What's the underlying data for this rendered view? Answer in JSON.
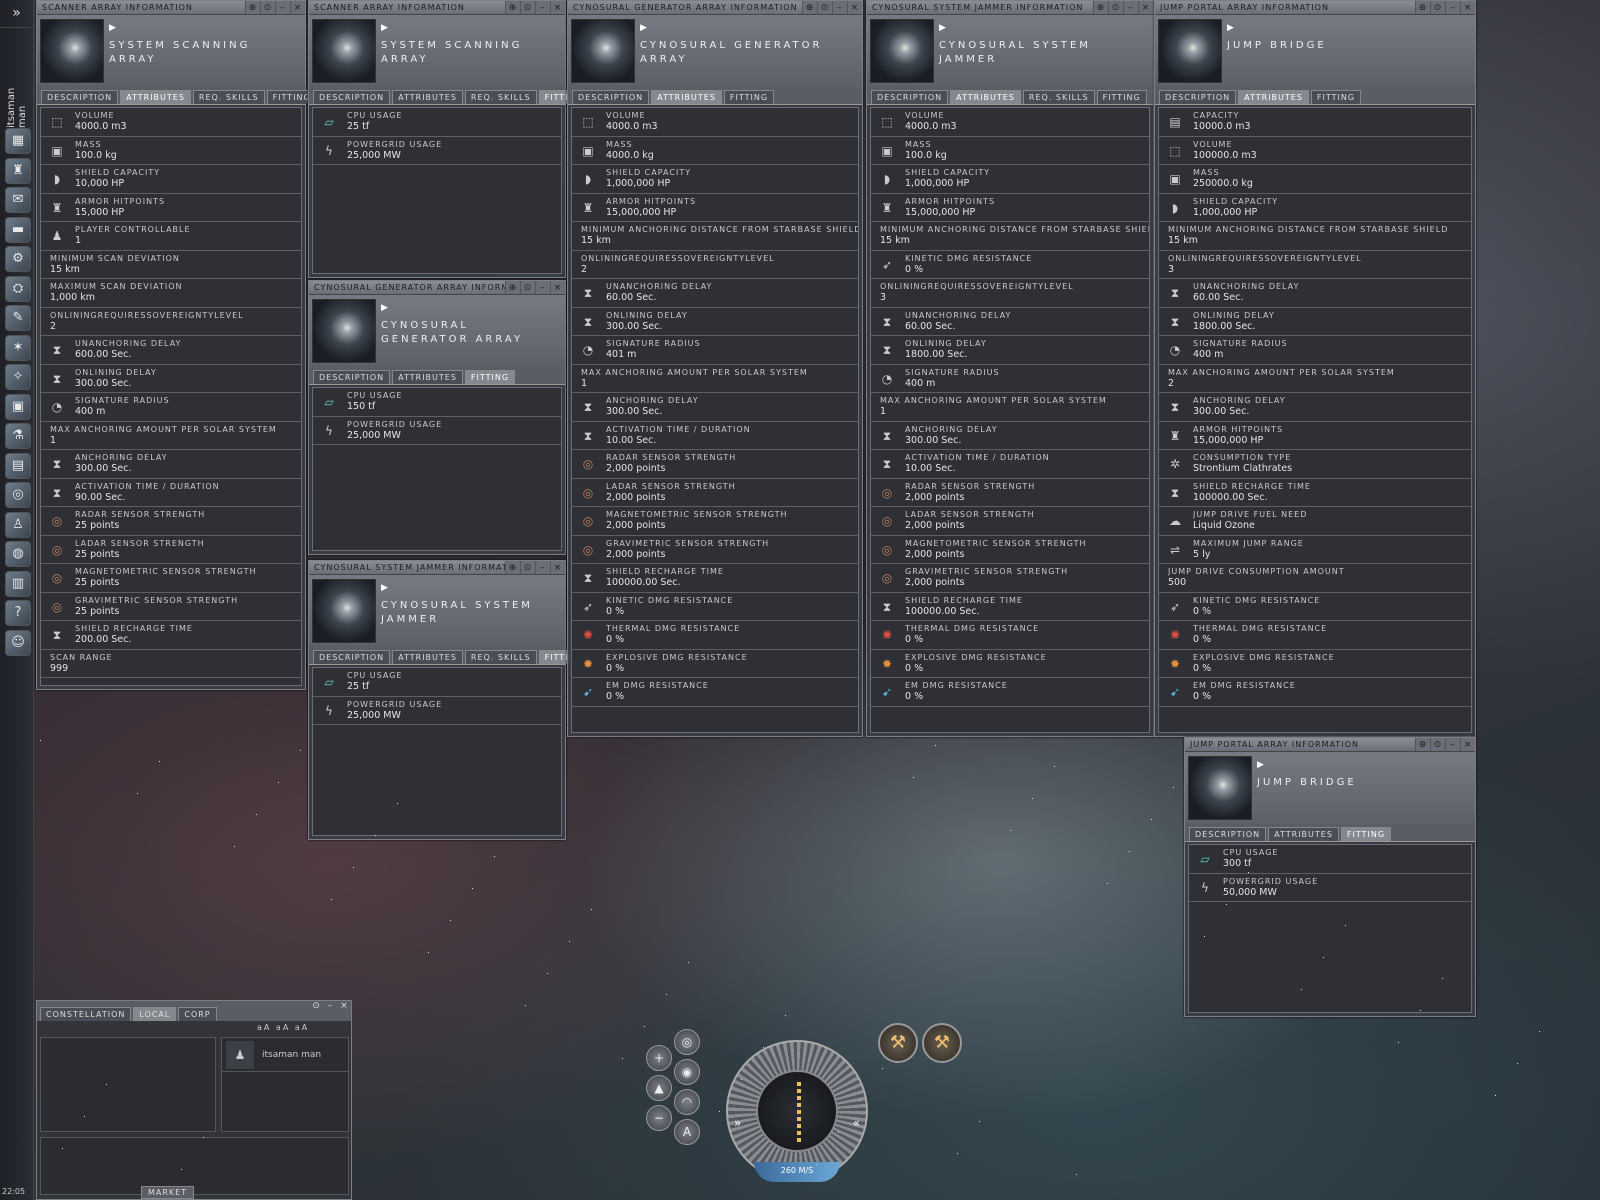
{
  "neocom": {
    "pilot": "itsaman man",
    "top": "»",
    "clock": "22:05",
    "buttons": [
      "▦",
      "♜",
      "✉",
      "▬",
      "⚙",
      "⛭",
      "✎",
      "✶",
      "✧",
      "▣",
      "⚗",
      "▤",
      "◎",
      "♙",
      "◍",
      "▥",
      "?",
      "☺"
    ]
  },
  "windows": [
    {
      "title": "SCANNER ARRAY INFORMATION",
      "name": "SYSTEM SCANNING ARRAY",
      "tabs": [
        "DESCRIPTION",
        "ATTRIBUTES",
        "REQ. SKILLS",
        "FITTING"
      ],
      "active": 1,
      "rows": [
        [
          "VOLUME",
          "4000.0 m3",
          "cube"
        ],
        [
          "MASS",
          "100.0 kg",
          "mass"
        ],
        [
          "SHIELD CAPACITY",
          "10,000 HP",
          "shield"
        ],
        [
          "ARMOR HITPOINTS",
          "15,000 HP",
          "armor"
        ],
        [
          "PLAYER CONTROLLABLE",
          "1",
          "person"
        ],
        [
          "MINIMUM SCAN DEVIATION",
          "15 km",
          ""
        ],
        [
          "MAXIMUM SCAN DEVIATION",
          "1,000 km",
          ""
        ],
        [
          "ONLININGREQUIRESSOVEREIGNTYLEVEL",
          "2",
          ""
        ],
        [
          "UNANCHORING DELAY",
          "600.00 Sec.",
          "hourglass"
        ],
        [
          "ONLINING DELAY",
          "300.00 Sec.",
          "hourglass"
        ],
        [
          "SIGNATURE RADIUS",
          "400 m",
          "signature"
        ],
        [
          "MAX ANCHORING AMOUNT PER SOLAR SYSTEM",
          "1",
          ""
        ],
        [
          "ANCHORING DELAY",
          "300.00 Sec.",
          "hourglass"
        ],
        [
          "ACTIVATION TIME / DURATION",
          "90.00 Sec.",
          "hourglass"
        ],
        [
          "RADAR SENSOR STRENGTH",
          "25 points",
          "sensor"
        ],
        [
          "LADAR SENSOR STRENGTH",
          "25 points",
          "sensor"
        ],
        [
          "MAGNETOMETRIC SENSOR STRENGTH",
          "25 points",
          "sensor"
        ],
        [
          "GRAVIMETRIC SENSOR STRENGTH",
          "25 points",
          "sensor"
        ],
        [
          "SHIELD RECHARGE TIME",
          "200.00 Sec.",
          "hourglass"
        ],
        [
          "SCAN RANGE",
          "999",
          ""
        ]
      ]
    },
    {
      "title": "SCANNER ARRAY INFORMATION",
      "name": "SYSTEM SCANNING ARRAY",
      "tabs": [
        "DESCRIPTION",
        "ATTRIBUTES",
        "REQ. SKILLS",
        "FITTING"
      ],
      "active": 3,
      "rows": [
        [
          "CPU USAGE",
          "25 tf",
          "cpu"
        ],
        [
          "POWERGRID USAGE",
          "25,000 MW",
          "power"
        ]
      ]
    },
    {
      "title": "CYNOSURAL GENERATOR ARRAY INFORMATI",
      "name": "CYNOSURAL GENERATOR ARRAY",
      "tabs": [
        "DESCRIPTION",
        "ATTRIBUTES",
        "FITTING"
      ],
      "active": 2,
      "rows": [
        [
          "CPU USAGE",
          "150 tf",
          "cpu"
        ],
        [
          "POWERGRID USAGE",
          "25,000 MW",
          "power"
        ]
      ]
    },
    {
      "title": "CYNOSURAL SYSTEM JAMMER INFORMATI",
      "name": "CYNOSURAL SYSTEM JAMMER",
      "tabs": [
        "DESCRIPTION",
        "ATTRIBUTES",
        "REQ. SKILLS",
        "FITTING"
      ],
      "active": 3,
      "rows": [
        [
          "CPU USAGE",
          "25 tf",
          "cpu"
        ],
        [
          "POWERGRID USAGE",
          "25,000 MW",
          "power"
        ]
      ]
    },
    {
      "title": "CYNOSURAL GENERATOR ARRAY INFORMATION",
      "name": "CYNOSURAL GENERATOR ARRAY",
      "tabs": [
        "DESCRIPTION",
        "ATTRIBUTES",
        "FITTING"
      ],
      "active": 1,
      "rows": [
        [
          "VOLUME",
          "4000.0 m3",
          "cube"
        ],
        [
          "MASS",
          "4000.0 kg",
          "mass"
        ],
        [
          "SHIELD CAPACITY",
          "1,000,000 HP",
          "shield"
        ],
        [
          "ARMOR HITPOINTS",
          "15,000,000 HP",
          "armor"
        ],
        [
          "MINIMUM ANCHORING DISTANCE FROM STARBASE SHIELD",
          "15 km",
          ""
        ],
        [
          "ONLININGREQUIRESSOVEREIGNTYLEVEL",
          "2",
          ""
        ],
        [
          "UNANCHORING DELAY",
          "60.00 Sec.",
          "hourglass"
        ],
        [
          "ONLINING DELAY",
          "300.00 Sec.",
          "hourglass"
        ],
        [
          "SIGNATURE RADIUS",
          "401 m",
          "signature"
        ],
        [
          "MAX ANCHORING AMOUNT PER SOLAR SYSTEM",
          "1",
          ""
        ],
        [
          "ANCHORING DELAY",
          "300.00 Sec.",
          "hourglass"
        ],
        [
          "ACTIVATION TIME / DURATION",
          "10.00 Sec.",
          "hourglass"
        ],
        [
          "RADAR SENSOR STRENGTH",
          "2,000 points",
          "sensor"
        ],
        [
          "LADAR SENSOR STRENGTH",
          "2,000 points",
          "sensor"
        ],
        [
          "MAGNETOMETRIC SENSOR STRENGTH",
          "2,000 points",
          "sensor"
        ],
        [
          "GRAVIMETRIC SENSOR STRENGTH",
          "2,000 points",
          "sensor"
        ],
        [
          "SHIELD RECHARGE TIME",
          "100000.00 Sec.",
          "hourglass"
        ],
        [
          "KINETIC DMG RESISTANCE",
          "0 %",
          "kinetic"
        ],
        [
          "THERMAL DMG RESISTANCE",
          "0 %",
          "thermal"
        ],
        [
          "EXPLOSIVE DMG RESISTANCE",
          "0 %",
          "explosive"
        ],
        [
          "EM DMG RESISTANCE",
          "0 %",
          "em"
        ]
      ]
    },
    {
      "title": "CYNOSURAL SYSTEM JAMMER INFORMATION",
      "name": "CYNOSURAL SYSTEM JAMMER",
      "tabs": [
        "DESCRIPTION",
        "ATTRIBUTES",
        "REQ. SKILLS",
        "FITTING"
      ],
      "active": 1,
      "rows": [
        [
          "VOLUME",
          "4000.0 m3",
          "cube"
        ],
        [
          "MASS",
          "100.0 kg",
          "mass"
        ],
        [
          "SHIELD CAPACITY",
          "1,000,000 HP",
          "shield"
        ],
        [
          "ARMOR HITPOINTS",
          "15,000,000 HP",
          "armor"
        ],
        [
          "MINIMUM ANCHORING DISTANCE FROM STARBASE SHIELD",
          "15 km",
          ""
        ],
        [
          "KINETIC DMG RESISTANCE",
          "0 %",
          "kinetic"
        ],
        [
          "ONLININGREQUIRESSOVEREIGNTYLEVEL",
          "3",
          ""
        ],
        [
          "UNANCHORING DELAY",
          "60.00 Sec.",
          "hourglass"
        ],
        [
          "ONLINING DELAY",
          "1800.00 Sec.",
          "hourglass"
        ],
        [
          "SIGNATURE RADIUS",
          "400 m",
          "signature"
        ],
        [
          "MAX ANCHORING AMOUNT PER SOLAR SYSTEM",
          "1",
          ""
        ],
        [
          "ANCHORING DELAY",
          "300.00 Sec.",
          "hourglass"
        ],
        [
          "ACTIVATION TIME / DURATION",
          "10.00 Sec.",
          "hourglass"
        ],
        [
          "RADAR SENSOR STRENGTH",
          "2,000 points",
          "sensor"
        ],
        [
          "LADAR SENSOR STRENGTH",
          "2,000 points",
          "sensor"
        ],
        [
          "MAGNETOMETRIC SENSOR STRENGTH",
          "2,000 points",
          "sensor"
        ],
        [
          "GRAVIMETRIC SENSOR STRENGTH",
          "2,000 points",
          "sensor"
        ],
        [
          "SHIELD RECHARGE TIME",
          "100000.00 Sec.",
          "hourglass"
        ],
        [
          "THERMAL DMG RESISTANCE",
          "0 %",
          "thermal"
        ],
        [
          "EXPLOSIVE DMG RESISTANCE",
          "0 %",
          "explosive"
        ],
        [
          "EM DMG RESISTANCE",
          "0 %",
          "em"
        ]
      ]
    },
    {
      "title": "JUMP PORTAL ARRAY INFORMATION",
      "name": "JUMP BRIDGE",
      "tabs": [
        "DESCRIPTION",
        "ATTRIBUTES",
        "FITTING"
      ],
      "active": 1,
      "rows": [
        [
          "CAPACITY",
          "10000.0 m3",
          "capacity"
        ],
        [
          "VOLUME",
          "100000.0 m3",
          "cube"
        ],
        [
          "MASS",
          "250000.0 kg",
          "mass"
        ],
        [
          "SHIELD CAPACITY",
          "1,000,000 HP",
          "shield"
        ],
        [
          "MINIMUM ANCHORING DISTANCE FROM STARBASE SHIELD",
          "15 km",
          ""
        ],
        [
          "ONLININGREQUIRESSOVEREIGNTYLEVEL",
          "3",
          ""
        ],
        [
          "UNANCHORING DELAY",
          "60.00 Sec.",
          "hourglass"
        ],
        [
          "ONLINING DELAY",
          "1800.00 Sec.",
          "hourglass"
        ],
        [
          "SIGNATURE RADIUS",
          "400 m",
          "signature"
        ],
        [
          "MAX ANCHORING AMOUNT PER SOLAR SYSTEM",
          "2",
          ""
        ],
        [
          "ANCHORING DELAY",
          "300.00 Sec.",
          "hourglass"
        ],
        [
          "ARMOR HITPOINTS",
          "15,000,000 HP",
          "armor"
        ],
        [
          "CONSUMPTION TYPE",
          "Strontium Clathrates",
          "gear"
        ],
        [
          "SHIELD RECHARGE TIME",
          "100000.00 Sec.",
          "hourglass"
        ],
        [
          "JUMP DRIVE FUEL NEED",
          "Liquid Ozone",
          "fuel"
        ],
        [
          "MAXIMUM JUMP RANGE",
          "5 ly",
          "range"
        ],
        [
          "JUMP DRIVE CONSUMPTION AMOUNT",
          "500",
          ""
        ],
        [
          "KINETIC DMG RESISTANCE",
          "0 %",
          "kinetic"
        ],
        [
          "THERMAL DMG RESISTANCE",
          "0 %",
          "thermal"
        ],
        [
          "EXPLOSIVE DMG RESISTANCE",
          "0 %",
          "explosive"
        ],
        [
          "EM DMG RESISTANCE",
          "0 %",
          "em"
        ]
      ]
    },
    {
      "title": "JUMP PORTAL ARRAY INFORMATION",
      "name": "JUMP BRIDGE",
      "tabs": [
        "DESCRIPTION",
        "ATTRIBUTES",
        "FITTING"
      ],
      "active": 2,
      "rows": [
        [
          "CPU USAGE",
          "300 tf",
          "cpu"
        ],
        [
          "POWERGRID USAGE",
          "50,000 MW",
          "power"
        ]
      ]
    }
  ],
  "chat": {
    "tabs": [
      "CONSTELLATION",
      "LOCAL",
      "CORP"
    ],
    "active": 1,
    "tools": "aA aA aA",
    "member": "itsaman man",
    "market": "MARKET"
  },
  "hud": {
    "speed": "260 M/S",
    "left_arrows": "»",
    "right_arrows": "«"
  }
}
